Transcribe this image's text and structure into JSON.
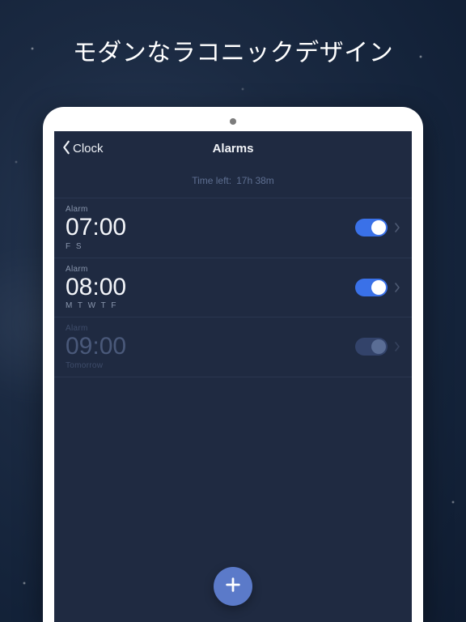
{
  "promo": {
    "headline": "モダンなラコニックデザイン"
  },
  "nav": {
    "back_label": "Clock",
    "title": "Alarms"
  },
  "time_left": {
    "label": "Time left:",
    "value": "17h 38m"
  },
  "alarms": [
    {
      "label": "Alarm",
      "time": "07:00",
      "sub": "F S",
      "enabled": true,
      "sub_is_word": false
    },
    {
      "label": "Alarm",
      "time": "08:00",
      "sub": "M T W T F",
      "enabled": true,
      "sub_is_word": false
    },
    {
      "label": "Alarm",
      "time": "09:00",
      "sub": "Tomorrow",
      "enabled": false,
      "sub_is_word": true
    }
  ],
  "icons": {
    "back": "chevron-left-icon",
    "disclosure": "chevron-right-icon",
    "add": "plus-icon"
  }
}
